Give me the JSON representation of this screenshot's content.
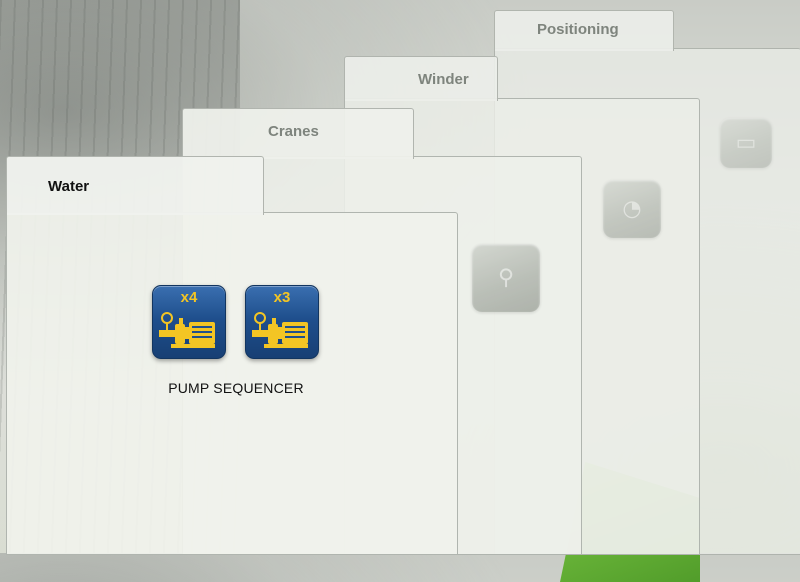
{
  "folders": {
    "positioning": {
      "label": "Positioning"
    },
    "winder": {
      "label": "Winder"
    },
    "cranes": {
      "label": "Cranes"
    },
    "water": {
      "label": "Water"
    }
  },
  "water_panel": {
    "pumps": [
      {
        "count_label": "x4",
        "icon": "pump-icon"
      },
      {
        "count_label": "x3",
        "icon": "pump-icon"
      }
    ],
    "caption": "PUMP SEQUENCER"
  },
  "colors": {
    "active_tab_text": "#111111",
    "inactive_tab_text": "#7e847d",
    "pump_icon_bg": "#1f4f8d",
    "pump_count_text": "#f3c524",
    "accent_green": "#5fae2e"
  }
}
